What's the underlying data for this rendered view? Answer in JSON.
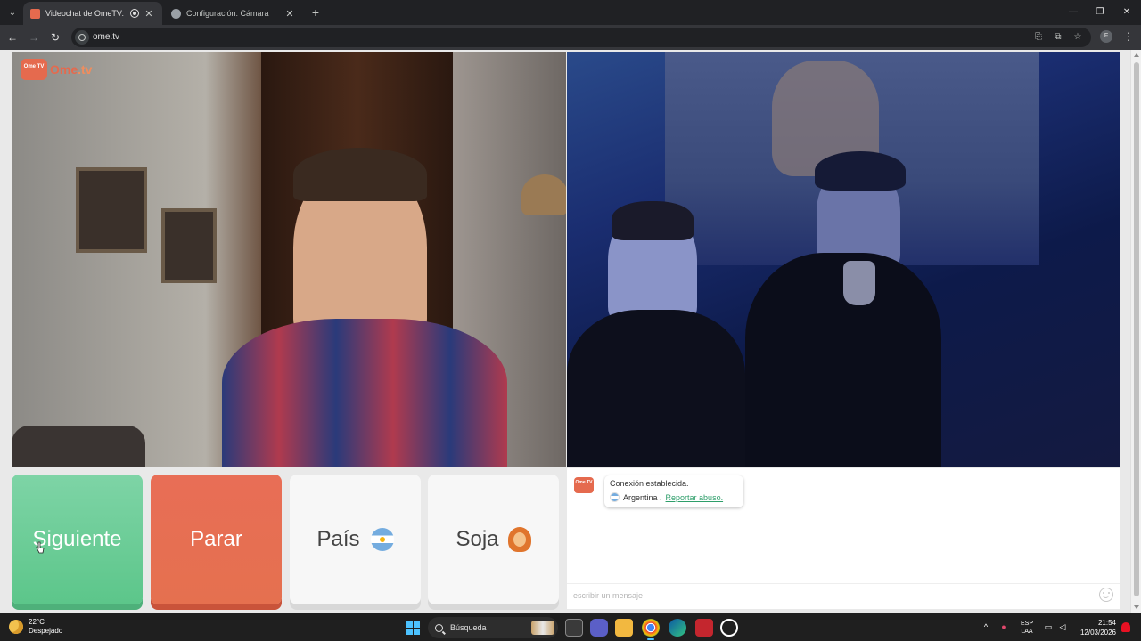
{
  "browser": {
    "tabs": [
      {
        "title": "Videochat de OmeTV: una",
        "active": true
      },
      {
        "title": "Configuración: Cámara",
        "active": false
      }
    ],
    "url": "ome.tv",
    "profile_initial": "F"
  },
  "page": {
    "logo": {
      "box_text": "Ome TV",
      "text_main": "Ome",
      "text_accent": ".tv"
    },
    "buttons": {
      "next": "Siguiente",
      "stop": "Parar",
      "country": "País",
      "gender": "Soja"
    },
    "chat": {
      "avatar_text": "Ome TV",
      "connection": "Conexión establecida.",
      "country": "Argentina .",
      "report": "Reportar abuso.",
      "input_placeholder": "escribir un mensaje"
    }
  },
  "taskbar": {
    "weather_temp": "22°C",
    "weather_desc": "Despejado",
    "search_label": "Búsqueda",
    "language": "ESP",
    "layout": "LAA",
    "time": "21:54",
    "date": "12/03/2026"
  },
  "colors": {
    "brand": "#e56a4e",
    "next_green": "#5cc68a",
    "stop_red": "#e5704f",
    "report_link": "#2e9e6a",
    "accent_blue": "#4cc2ff"
  }
}
